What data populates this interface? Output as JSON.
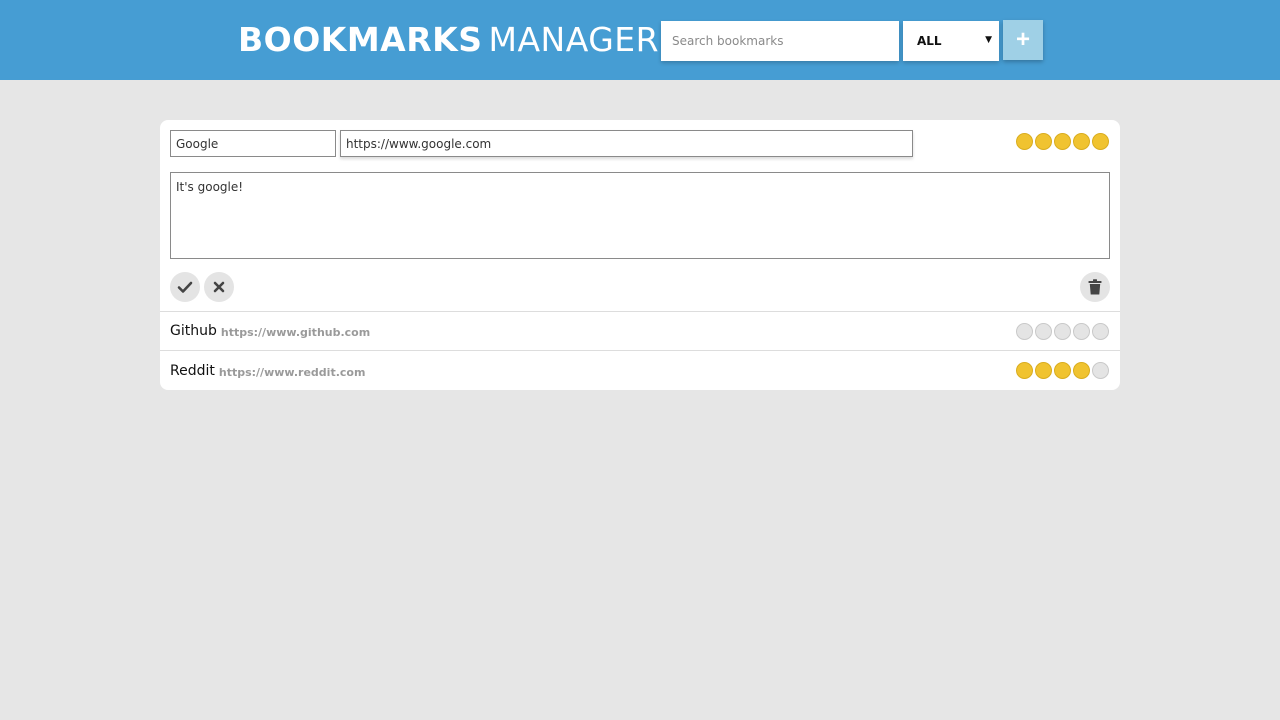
{
  "header": {
    "title_bold": "BOOKMARKS",
    "title_light": "MANAGER",
    "search_placeholder": "Search bookmarks",
    "filter_value": "ALL",
    "add_label": "+"
  },
  "editing": {
    "name": "Google",
    "url": "https://www.google.com",
    "description": "It's google!",
    "rating": 5
  },
  "bookmarks": [
    {
      "title": "Github",
      "url": "https://www.github.com",
      "rating": 0
    },
    {
      "title": "Reddit",
      "url": "https://www.reddit.com",
      "rating": 4
    }
  ],
  "rating_max": 5,
  "colors": {
    "header": "#469dd3",
    "star_on": "#f0c330",
    "star_off": "#e4e4e4",
    "add_button": "#9fd0e6"
  },
  "icons": {
    "save": "check-icon",
    "cancel": "close-icon",
    "delete": "trash-icon",
    "filter": "caret-down-icon"
  }
}
